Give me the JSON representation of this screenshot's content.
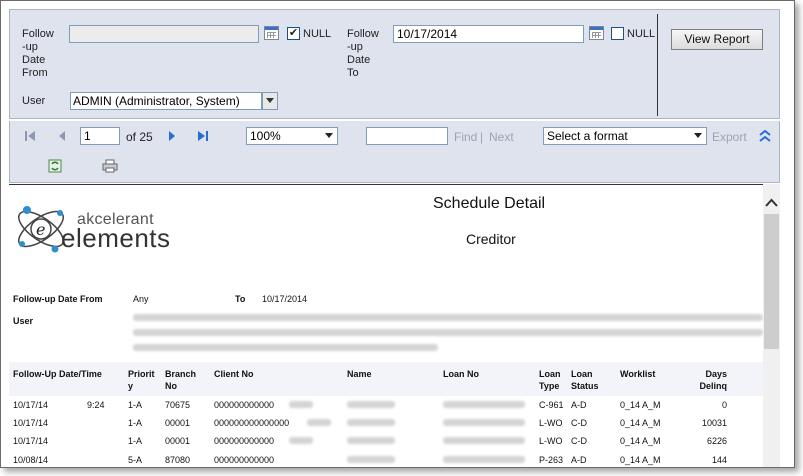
{
  "params": {
    "from_label": "Follow-up Date From",
    "from_label_lines": [
      "Follow",
      "-up",
      "Date",
      "From"
    ],
    "from_value": "",
    "from_null_label": "NULL",
    "from_null_checked": "✔",
    "to_label_lines": [
      "Follow",
      "-up",
      "Date",
      "To"
    ],
    "to_value": "10/17/2014",
    "to_null_label": "NULL",
    "to_null_checked": "",
    "user_label": "User",
    "user_value": "ADMIN  (Administrator, System)",
    "view_report": "View Report"
  },
  "toolbar": {
    "page_current": "1",
    "page_of": "of 25",
    "zoom": "100%",
    "find_value": "",
    "find": "Find",
    "find_sep": "|",
    "next": "Next",
    "format_placeholder": "Select a format",
    "export": "Export",
    "first_icon": "first-page-icon",
    "prev_icon": "previous-page-icon",
    "next_icon": "next-page-icon",
    "last_icon": "last-page-icon",
    "refresh_icon": "refresh-icon",
    "print_icon": "print-icon",
    "collapse_icon": "collapse-icon",
    "accent": "#2a6bd6"
  },
  "report": {
    "title": "Schedule Detail",
    "subtitle": "Creditor",
    "logo_word1": "akcelerant",
    "logo_word2": "elements",
    "followup_from_label": "Follow-up Date From",
    "followup_from_value": "Any",
    "to_label": "To",
    "to_value": "10/17/2014",
    "user_label": "User",
    "columns": {
      "followup": "Follow-Up Date/Time",
      "priority": "Priorit y",
      "branch": "Branch No",
      "client": "Client No",
      "name": "Name",
      "loan_no": "Loan No",
      "loan_type": "Loan Type",
      "loan_status": "Loan Status",
      "worklist": "Worklist",
      "days_delinq": "Days Delinq"
    },
    "rows": [
      {
        "date": "10/17/14",
        "time": "9:24",
        "priority": "1-A",
        "branch": "70675",
        "client": "000000000000",
        "loan_type": "C-961",
        "loan_status": "A-D",
        "worklist": "0_14 A_M",
        "days": "0"
      },
      {
        "date": "10/17/14",
        "time": "",
        "priority": "1-A",
        "branch": "00001",
        "client": "000000000000000",
        "loan_type": "L-WO",
        "loan_status": "C-D",
        "worklist": "0_14 A_M",
        "days": "10031"
      },
      {
        "date": "10/17/14",
        "time": "",
        "priority": "1-A",
        "branch": "00001",
        "client": "000000000000",
        "loan_type": "L-WO",
        "loan_status": "C-D",
        "worklist": "0_14 A_M",
        "days": "6226"
      },
      {
        "date": "10/08/14",
        "time": "",
        "priority": "5-A",
        "branch": "87080",
        "client": "000000000000",
        "loan_type": "P-263",
        "loan_status": "A-D",
        "worklist": "0_14 A_M",
        "days": "144"
      }
    ]
  }
}
